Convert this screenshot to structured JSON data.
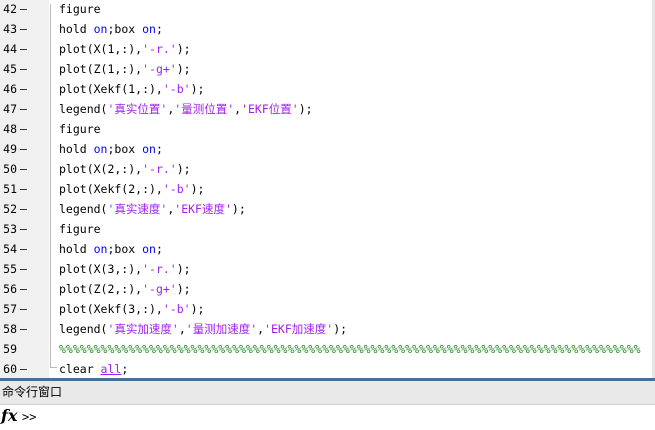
{
  "editor": {
    "lines": [
      {
        "num": "42",
        "marker": "–",
        "parts": [
          {
            "t": "figure",
            "c": "plain"
          }
        ]
      },
      {
        "num": "43",
        "marker": "–",
        "parts": [
          {
            "t": "hold ",
            "c": "plain"
          },
          {
            "t": "on",
            "c": "kw"
          },
          {
            "t": ";box ",
            "c": "plain"
          },
          {
            "t": "on",
            "c": "kw"
          },
          {
            "t": ";",
            "c": "plain"
          }
        ]
      },
      {
        "num": "44",
        "marker": "–",
        "parts": [
          {
            "t": "plot(X(1,:),",
            "c": "plain"
          },
          {
            "t": "'-r.'",
            "c": "str"
          },
          {
            "t": ");",
            "c": "plain"
          }
        ]
      },
      {
        "num": "45",
        "marker": "–",
        "parts": [
          {
            "t": "plot(Z(1,:),",
            "c": "plain"
          },
          {
            "t": "'-g+'",
            "c": "str"
          },
          {
            "t": ");",
            "c": "plain"
          }
        ]
      },
      {
        "num": "46",
        "marker": "–",
        "parts": [
          {
            "t": "plot(Xekf(1,:),",
            "c": "plain"
          },
          {
            "t": "'-b'",
            "c": "str"
          },
          {
            "t": ");",
            "c": "plain"
          }
        ]
      },
      {
        "num": "47",
        "marker": "–",
        "parts": [
          {
            "t": "legend(",
            "c": "plain"
          },
          {
            "t": "'真实位置'",
            "c": "str"
          },
          {
            "t": ",",
            "c": "plain"
          },
          {
            "t": "'量测位置'",
            "c": "str"
          },
          {
            "t": ",",
            "c": "plain"
          },
          {
            "t": "'EKF位置'",
            "c": "str"
          },
          {
            "t": ");",
            "c": "plain"
          }
        ]
      },
      {
        "num": "48",
        "marker": "–",
        "parts": [
          {
            "t": "figure",
            "c": "plain"
          }
        ]
      },
      {
        "num": "49",
        "marker": "–",
        "parts": [
          {
            "t": "hold ",
            "c": "plain"
          },
          {
            "t": "on",
            "c": "kw"
          },
          {
            "t": ";box ",
            "c": "plain"
          },
          {
            "t": "on",
            "c": "kw"
          },
          {
            "t": ";",
            "c": "plain"
          }
        ]
      },
      {
        "num": "50",
        "marker": "–",
        "parts": [
          {
            "t": "plot(X(2,:),",
            "c": "plain"
          },
          {
            "t": "'-r.'",
            "c": "str"
          },
          {
            "t": ");",
            "c": "plain"
          }
        ]
      },
      {
        "num": "51",
        "marker": "–",
        "parts": [
          {
            "t": "plot(Xekf(2,:),",
            "c": "plain"
          },
          {
            "t": "'-b'",
            "c": "str"
          },
          {
            "t": ");",
            "c": "plain"
          }
        ]
      },
      {
        "num": "52",
        "marker": "–",
        "parts": [
          {
            "t": "legend(",
            "c": "plain"
          },
          {
            "t": "'真实速度'",
            "c": "str"
          },
          {
            "t": ",",
            "c": "plain"
          },
          {
            "t": "'EKF速度'",
            "c": "str"
          },
          {
            "t": ");",
            "c": "plain"
          }
        ]
      },
      {
        "num": "53",
        "marker": "–",
        "parts": [
          {
            "t": "figure",
            "c": "plain"
          }
        ]
      },
      {
        "num": "54",
        "marker": "–",
        "parts": [
          {
            "t": "hold ",
            "c": "plain"
          },
          {
            "t": "on",
            "c": "kw"
          },
          {
            "t": ";box ",
            "c": "plain"
          },
          {
            "t": "on",
            "c": "kw"
          },
          {
            "t": ";",
            "c": "plain"
          }
        ]
      },
      {
        "num": "55",
        "marker": "–",
        "parts": [
          {
            "t": "plot(X(3,:),",
            "c": "plain"
          },
          {
            "t": "'-r.'",
            "c": "str"
          },
          {
            "t": ");",
            "c": "plain"
          }
        ]
      },
      {
        "num": "56",
        "marker": "–",
        "parts": [
          {
            "t": "plot(Z(2,:),",
            "c": "plain"
          },
          {
            "t": "'-g+'",
            "c": "str"
          },
          {
            "t": ");",
            "c": "plain"
          }
        ]
      },
      {
        "num": "57",
        "marker": "–",
        "parts": [
          {
            "t": "plot(Xekf(3,:),",
            "c": "plain"
          },
          {
            "t": "'-b'",
            "c": "str"
          },
          {
            "t": ");",
            "c": "plain"
          }
        ]
      },
      {
        "num": "58",
        "marker": "–",
        "parts": [
          {
            "t": "legend(",
            "c": "plain"
          },
          {
            "t": "'真实加速度'",
            "c": "str"
          },
          {
            "t": ",",
            "c": "plain"
          },
          {
            "t": "'量测加速度'",
            "c": "str"
          },
          {
            "t": ",",
            "c": "plain"
          },
          {
            "t": "'EKF加速度'",
            "c": "str"
          },
          {
            "t": ");",
            "c": "plain"
          }
        ]
      },
      {
        "num": "59",
        "marker": "",
        "parts": [
          {
            "t": "%%%%%%%%%%%%%%%%%%%%%%%%%%%%%%%%%%%%%%%%%%%%%%%%%%%%%%%%%%%%%%%%%%%%%%%%%%%%%%%%%%%%",
            "c": "cmt"
          }
        ]
      },
      {
        "num": "60",
        "marker": "–",
        "parts": [
          {
            "t": "clear ",
            "c": "plain"
          },
          {
            "t": "all",
            "c": "ul"
          },
          {
            "t": ";",
            "c": "plain"
          }
        ]
      }
    ]
  },
  "command_window": {
    "title": "命令行窗口",
    "fx_label": "fx",
    "prompt": ">>"
  },
  "colors": {
    "keyword": "#0000ff",
    "string": "#a020f0",
    "comment": "#228b22",
    "divider": "#4a6f94"
  }
}
